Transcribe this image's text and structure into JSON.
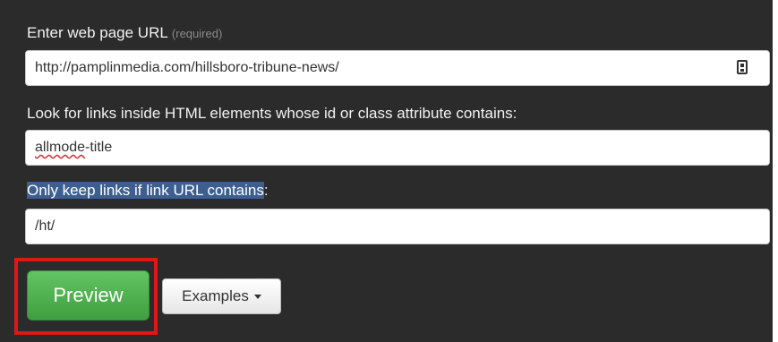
{
  "form": {
    "url_label": "Enter web page URL",
    "url_hint": "(required)",
    "url_value": "http://pamplinmedia.com/hillsboro-tribune-news/",
    "url_field_icon": "contact-card-icon",
    "selector_label": "Look for links inside HTML elements whose id or class attribute contains:",
    "selector_value_part1": "allmode",
    "selector_value_part2": "-title",
    "filter_label_selected": "Only keep links if link URL contains",
    "filter_label_rest": ":",
    "filter_value": "/ht/"
  },
  "actions": {
    "preview_label": "Preview",
    "examples_label": "Examples"
  },
  "colors": {
    "panel_background": "#2b2b2b",
    "preview_green": "#4cae4c",
    "highlight_red": "#e0161b",
    "text_selection": "#3d5f8f"
  }
}
